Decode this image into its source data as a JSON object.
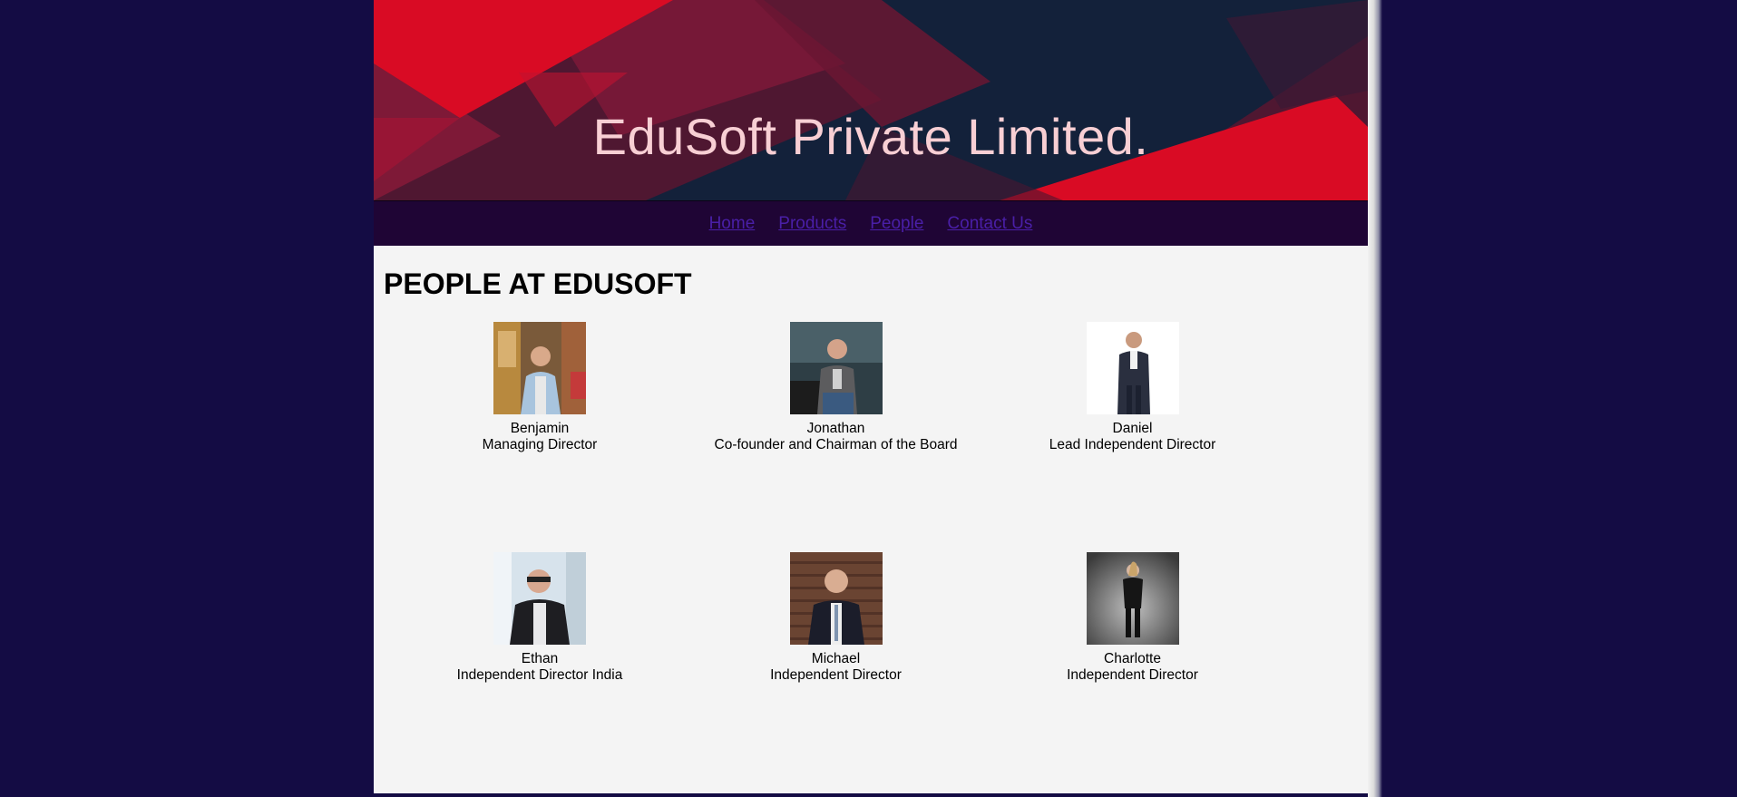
{
  "banner": {
    "title": "EduSoft Private Limited."
  },
  "nav": {
    "items": [
      {
        "label": "Home"
      },
      {
        "label": "Products"
      },
      {
        "label": "People"
      },
      {
        "label": "Contact Us"
      }
    ]
  },
  "main": {
    "heading": "PEOPLE AT EDUSOFT",
    "people": [
      {
        "name": "Benjamin",
        "role": "Managing Director"
      },
      {
        "name": "Jonathan",
        "role": "Co-founder and Chairman of the Board"
      },
      {
        "name": "Daniel",
        "role": "Lead Independent Director"
      },
      {
        "name": "Ethan",
        "role": "Independent Director India"
      },
      {
        "name": "Michael",
        "role": "Independent Director"
      },
      {
        "name": "Charlotte",
        "role": "Independent Director"
      }
    ]
  },
  "colors": {
    "outer_background": "#140c44",
    "banner_background": "#13213a",
    "banner_accent_red": "#d90b24",
    "banner_title": "#f8cfd4",
    "nav_background": "#1f0535",
    "nav_link": "#4a1fa8",
    "content_background": "#f4f4f4"
  }
}
